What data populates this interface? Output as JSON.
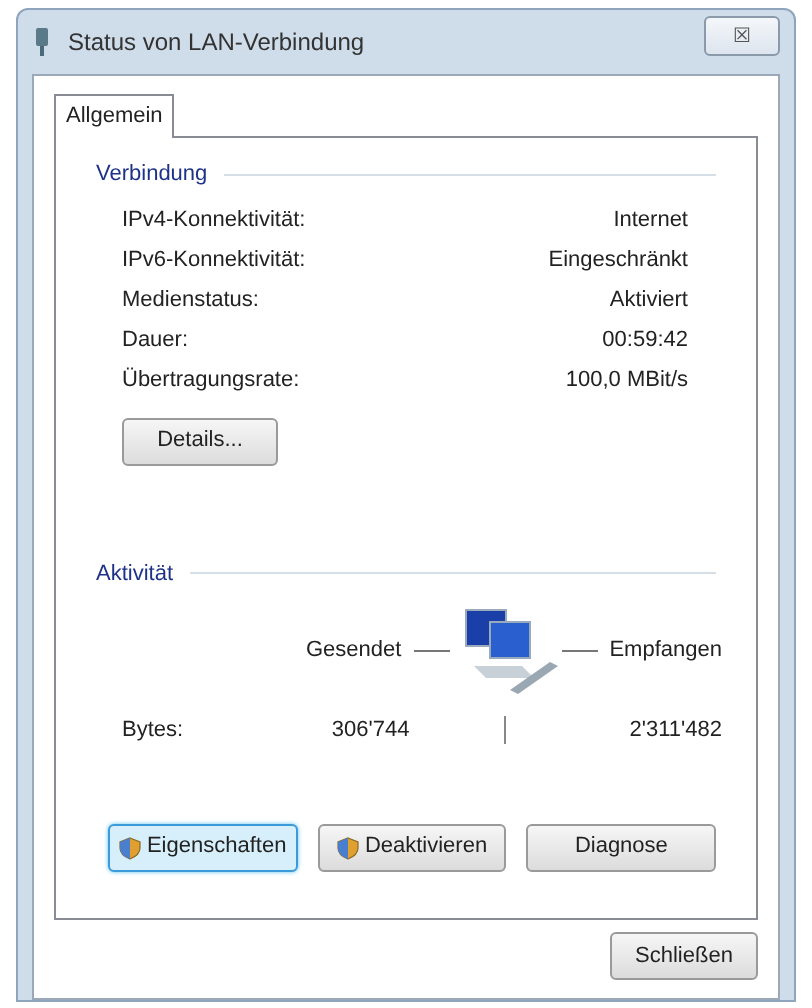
{
  "window": {
    "title": "Status von LAN-Verbindung",
    "close": "☒"
  },
  "tabs": [
    {
      "label": "Allgemein",
      "selected": true
    }
  ],
  "connection": {
    "heading": "Verbindung",
    "rows": [
      {
        "label": "IPv4-Konnektivität:",
        "value": "Internet"
      },
      {
        "label": "IPv6-Konnektivität:",
        "value": "Eingeschränkt"
      },
      {
        "label": "Medienstatus:",
        "value": "Aktiviert"
      },
      {
        "label": "Dauer:",
        "value": "00:59:42"
      },
      {
        "label": "Übertragungsrate:",
        "value": "100,0 MBit/s"
      }
    ],
    "details_button": "Details..."
  },
  "activity": {
    "heading": "Aktivität",
    "sent_label": "Gesendet",
    "received_label": "Empfangen",
    "bytes_label": "Bytes:",
    "bytes_sent": "306'744",
    "bytes_received": "2'311'482"
  },
  "actions": [
    {
      "label": "Eigenschaften",
      "kind": "shield",
      "focused": true
    },
    {
      "label": "Deaktivieren",
      "kind": "shield",
      "focused": false
    },
    {
      "label": "Diagnose",
      "kind": "plain",
      "focused": false
    }
  ],
  "close_button": "Schließen"
}
